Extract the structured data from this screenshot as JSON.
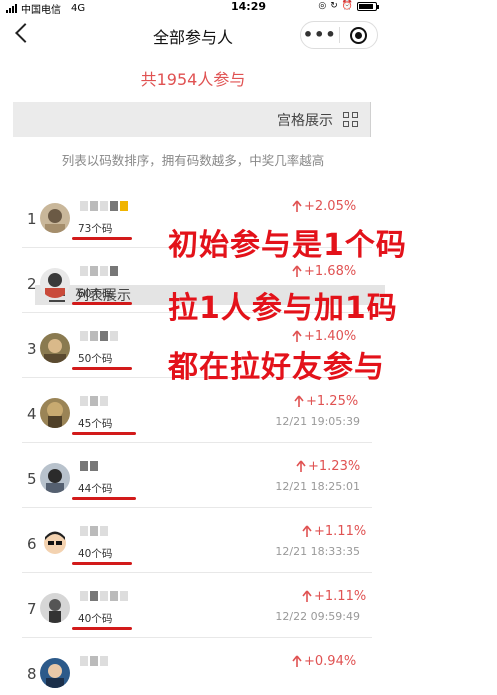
{
  "status_bar": {
    "carrier": "中国电信",
    "network": "4G",
    "time": "14:29",
    "battery_level": 0.9
  },
  "nav": {
    "title": "全部参与人",
    "back_icon": "chevron-left-icon",
    "more_icon": "more-dots-icon",
    "close_icon": "close-target-icon"
  },
  "summary": {
    "participants_text": "共1954人参与"
  },
  "view_switch": {
    "grid_label": "宫格展示",
    "list_label": "列表展示"
  },
  "sort_note": "列表以码数排序，拥有码数越多，中奖几率越高",
  "annotations": [
    "初始参与是1个码",
    "拉1人参与加1码",
    "都在拉好友参与"
  ],
  "colors": {
    "accent_red": "#e05252",
    "annotation_red": "#e3121a",
    "underline_red": "#d21a1a"
  },
  "participants": [
    {
      "rank": "1",
      "codes": "73个码",
      "change": "+2.05%",
      "time": ""
    },
    {
      "rank": "2",
      "codes": "60个码",
      "change": "+1.68%",
      "time": ""
    },
    {
      "rank": "3",
      "codes": "50个码",
      "change": "+1.40%",
      "time": ""
    },
    {
      "rank": "4",
      "codes": "45个码",
      "change": "+1.25%",
      "time": "12/21 19:05:39"
    },
    {
      "rank": "5",
      "codes": "44个码",
      "change": "+1.23%",
      "time": "12/21 18:25:01"
    },
    {
      "rank": "6",
      "codes": "40个码",
      "change": "+1.11%",
      "time": "12/21 18:33:35"
    },
    {
      "rank": "7",
      "codes": "40个码",
      "change": "+1.11%",
      "time": "12/22 09:59:49"
    },
    {
      "rank": "8",
      "codes": "",
      "change": "+0.94%",
      "time": ""
    }
  ]
}
